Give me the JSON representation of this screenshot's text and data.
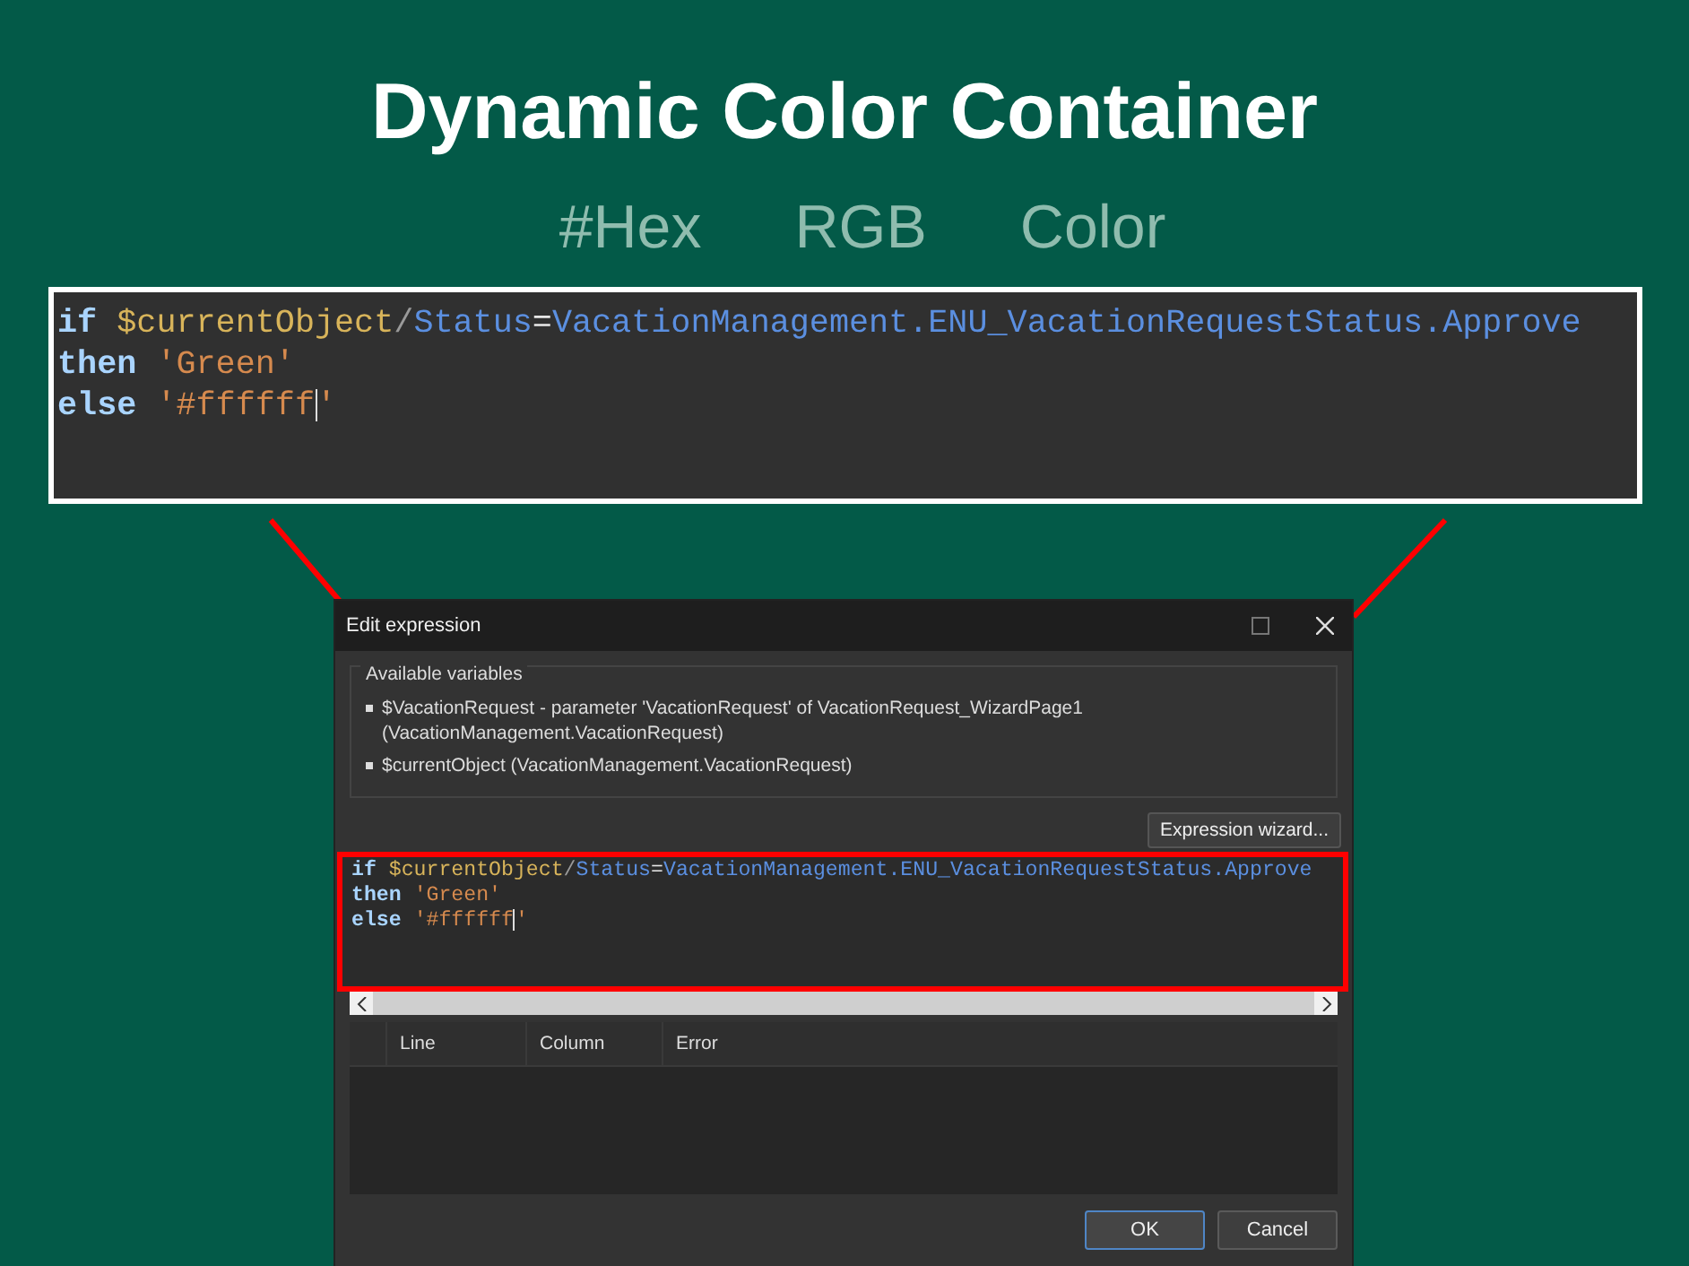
{
  "title": "Dynamic Color Container",
  "formats": [
    {
      "label": "#Hex"
    },
    {
      "label": "RGB"
    },
    {
      "label": "Color"
    }
  ],
  "zoom_panel": {
    "lines": [
      [
        {
          "kind": "keyword",
          "text": "if"
        },
        {
          "kind": "variable",
          "text": "$currentObject"
        },
        {
          "kind": "operator",
          "text": "/"
        },
        {
          "kind": "member",
          "text": "Status"
        },
        {
          "kind": "plain",
          "text": "="
        },
        {
          "kind": "member",
          "text": "VacationManagement.ENU_VacationRequestStatus.Approve"
        }
      ],
      [
        {
          "kind": "keyword",
          "text": "then"
        },
        {
          "kind": "string",
          "text": "'Green'"
        }
      ],
      [
        {
          "kind": "keyword",
          "text": "else"
        },
        {
          "kind": "string",
          "text": "'#ffffff",
          "cursor": true
        },
        {
          "kind": "string",
          "text": "'"
        }
      ]
    ]
  },
  "dialog": {
    "title": "Edit expression",
    "variables": {
      "legend": "Available variables",
      "items": [
        "$VacationRequest - parameter 'VacationRequest' of VacationRequest_WizardPage1 (VacationManagement.VacationRequest)",
        "$currentObject (VacationManagement.VacationRequest)"
      ]
    },
    "wizard_button": "Expression wizard...",
    "expression": {
      "lines": [
        [
          {
            "kind": "keyword",
            "text": "if"
          },
          {
            "kind": "variable",
            "text": "$currentObject"
          },
          {
            "kind": "operator",
            "text": "/"
          },
          {
            "kind": "member",
            "text": "Status"
          },
          {
            "kind": "plain",
            "text": "="
          },
          {
            "kind": "member",
            "text": "VacationManagement.ENU_VacationRequestStatus.Approve"
          }
        ],
        [
          {
            "kind": "keyword",
            "text": "then"
          },
          {
            "kind": "string",
            "text": "'Green'"
          }
        ],
        [
          {
            "kind": "keyword",
            "text": "else"
          },
          {
            "kind": "string",
            "text": "'#ffffff",
            "cursor": true
          },
          {
            "kind": "string",
            "text": "'"
          }
        ]
      ]
    },
    "errors": {
      "columns": [
        "Line",
        "Column",
        "Error"
      ]
    },
    "buttons": [
      {
        "label": "OK",
        "default": true
      },
      {
        "label": "Cancel",
        "default": false
      }
    ]
  }
}
